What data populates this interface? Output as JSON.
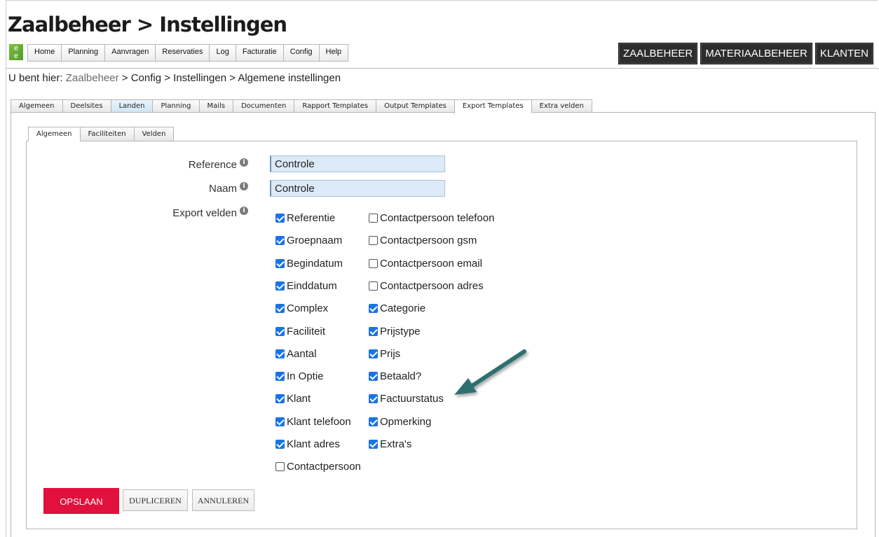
{
  "header": {
    "title": "Zaalbeheer > Instellingen",
    "logo_text_top": "e",
    "logo_text_bottom": "e",
    "menu": [
      "Home",
      "Planning",
      "Aanvragen",
      "Reservaties",
      "Log",
      "Facturatie",
      "Config",
      "Help"
    ],
    "module_buttons": [
      "ZAALBEHEER",
      "MATERIAALBEHEER",
      "KLANTEN"
    ]
  },
  "breadcrumb": {
    "prefix": "U bent hier:",
    "link": "Zaalbeheer",
    "rest": "> Config > Instellingen > Algemene instellingen"
  },
  "main_tabs": {
    "items": [
      "Algemeen",
      "Deelsites",
      "Landen",
      "Planning",
      "Mails",
      "Documenten",
      "Rapport Templates",
      "Output Templates",
      "Export Templates",
      "Extra velden"
    ],
    "active": "Export Templates",
    "highlighted": "Landen"
  },
  "sub_tabs": {
    "items": [
      "Algemeen",
      "Faciliteiten",
      "Velden"
    ],
    "active": "Algemeen"
  },
  "form": {
    "reference": {
      "label": "Reference",
      "value": "Controle"
    },
    "naam": {
      "label": "Naam",
      "value": "Controle"
    },
    "export_label": "Export velden",
    "info_icon": "i",
    "column1": [
      {
        "label": "Referentie",
        "checked": true
      },
      {
        "label": "Groepnaam",
        "checked": true
      },
      {
        "label": "Begindatum",
        "checked": true
      },
      {
        "label": "Einddatum",
        "checked": true
      },
      {
        "label": "Complex",
        "checked": true
      },
      {
        "label": "Faciliteit",
        "checked": true
      },
      {
        "label": "Aantal",
        "checked": true
      },
      {
        "label": "In Optie",
        "checked": true
      },
      {
        "label": "Klant",
        "checked": true
      },
      {
        "label": "Klant telefoon",
        "checked": true
      },
      {
        "label": "Klant adres",
        "checked": true
      },
      {
        "label": "Contactpersoon",
        "checked": false
      }
    ],
    "column2": [
      {
        "label": "Contactpersoon telefoon",
        "checked": false
      },
      {
        "label": "Contactpersoon gsm",
        "checked": false
      },
      {
        "label": "Contactpersoon email",
        "checked": false
      },
      {
        "label": "Contactpersoon adres",
        "checked": false
      },
      {
        "label": "Categorie",
        "checked": true
      },
      {
        "label": "Prijstype",
        "checked": true
      },
      {
        "label": "Prijs",
        "checked": true
      },
      {
        "label": "Betaald?",
        "checked": true
      },
      {
        "label": "Factuurstatus",
        "checked": true
      },
      {
        "label": "Opmerking",
        "checked": true
      },
      {
        "label": "Extra's",
        "checked": true
      }
    ]
  },
  "actions": {
    "save": "OPSLAAN",
    "duplicate": "DUPLICEREN",
    "cancel": "ANNULEREN"
  },
  "colors": {
    "save_button": "#e2103c",
    "checkbox_checked": "#1a73e8",
    "annotation_arrow": "#2f6f6f",
    "module_button_bg": "#2d2d2d"
  },
  "annotation": {
    "icon": "arrow-icon",
    "points_to": "Factuurstatus"
  }
}
